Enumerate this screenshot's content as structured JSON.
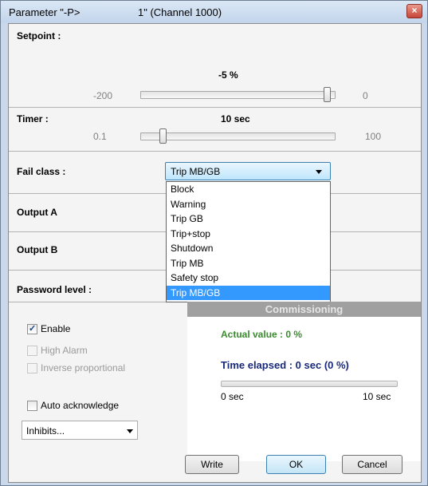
{
  "window": {
    "title_prefix": "Parameter \"-P>",
    "title_channel": "1\" (Channel 1000)",
    "close_glyph": "×"
  },
  "setpoint": {
    "label": "Setpoint :",
    "value": "-5 %",
    "min": "-200",
    "max": "0",
    "slider_fraction": 0.975
  },
  "timer": {
    "label": "Timer :",
    "value": "10 sec",
    "min": "0.1",
    "max": "100",
    "slider_fraction": 0.1
  },
  "fail_class": {
    "label": "Fail class :",
    "selected": "Trip MB/GB",
    "options": [
      "Block",
      "Warning",
      "Trip GB",
      "Trip+stop",
      "Shutdown",
      "Trip MB",
      "Safety stop",
      "Trip MB/GB"
    ],
    "highlighted_index": 7
  },
  "output_a": {
    "label": "Output A"
  },
  "output_b": {
    "label": "Output B"
  },
  "password": {
    "label": "Password level :"
  },
  "options": {
    "enable": {
      "label": "Enable",
      "checked": true
    },
    "high_alarm": {
      "label": "High Alarm",
      "checked": false,
      "disabled": true
    },
    "inverse": {
      "label": "Inverse proportional",
      "checked": false,
      "disabled": true
    },
    "auto_ack": {
      "label": "Auto acknowledge",
      "checked": false
    },
    "inhibits": "Inhibits..."
  },
  "commissioning": {
    "header": "Commissioning",
    "actual_value": "Actual value : 0 %",
    "time_elapsed": "Time elapsed : 0 sec (0 %)",
    "progress_fraction": 0,
    "range_min": "0 sec",
    "range_max": "10 sec"
  },
  "buttons": {
    "write": "Write",
    "ok": "OK",
    "cancel": "Cancel"
  },
  "colors": {
    "accent_green": "#3a8a2e",
    "accent_navy": "#1a2a7a",
    "selection": "#3399ff"
  }
}
